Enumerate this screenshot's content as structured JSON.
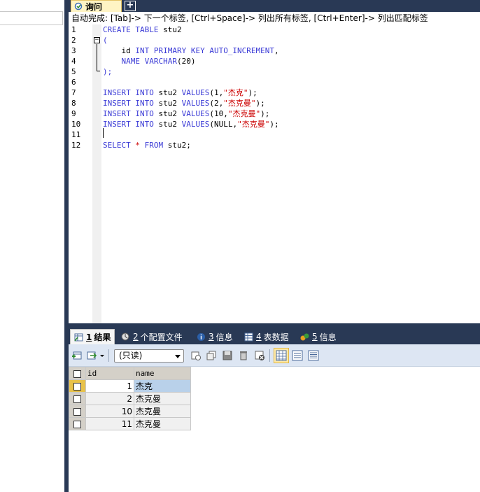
{
  "query_tab": {
    "label": "询问",
    "add_label": "+"
  },
  "hint": "自动完成: [Tab]-> 下一个标签, [Ctrl+Space]-> 列出所有标签, [Ctrl+Enter]-> 列出匹配标签",
  "editor": {
    "line_numbers": [
      "1",
      "2",
      "3",
      "4",
      "5",
      "6",
      "7",
      "8",
      "9",
      "10",
      "11",
      "12"
    ],
    "fold_open": "−",
    "lines": [
      [
        {
          "t": "CREATE TABLE ",
          "c": "kw"
        },
        {
          "t": "stu2",
          "c": ""
        }
      ],
      [
        {
          "t": "(",
          "c": "kw"
        }
      ],
      [
        {
          "t": "    id ",
          "c": ""
        },
        {
          "t": "INT PRIMARY KEY AUTO_INCREMENT",
          "c": "kw"
        },
        {
          "t": ",",
          "c": ""
        }
      ],
      [
        {
          "t": "    NAME VARCHAR",
          "c": "kw"
        },
        {
          "t": "(20)",
          "c": ""
        }
      ],
      [
        {
          "t": ");",
          "c": "kw"
        }
      ],
      [],
      [
        {
          "t": "INSERT INTO ",
          "c": "kw"
        },
        {
          "t": "stu2 ",
          "c": ""
        },
        {
          "t": "VALUES",
          "c": "kw"
        },
        {
          "t": "(1,",
          "c": ""
        },
        {
          "t": "\"杰克\"",
          "c": "str"
        },
        {
          "t": ");",
          "c": ""
        }
      ],
      [
        {
          "t": "INSERT INTO ",
          "c": "kw"
        },
        {
          "t": "stu2 ",
          "c": ""
        },
        {
          "t": "VALUES",
          "c": "kw"
        },
        {
          "t": "(2,",
          "c": ""
        },
        {
          "t": "\"杰克曼\"",
          "c": "str"
        },
        {
          "t": ");",
          "c": ""
        }
      ],
      [
        {
          "t": "INSERT INTO ",
          "c": "kw"
        },
        {
          "t": "stu2 ",
          "c": ""
        },
        {
          "t": "VALUES",
          "c": "kw"
        },
        {
          "t": "(10,",
          "c": ""
        },
        {
          "t": "\"杰克曼\"",
          "c": "str"
        },
        {
          "t": ");",
          "c": ""
        }
      ],
      [
        {
          "t": "INSERT INTO ",
          "c": "kw"
        },
        {
          "t": "stu2 ",
          "c": ""
        },
        {
          "t": "VALUES",
          "c": "kw"
        },
        {
          "t": "(NULL,",
          "c": ""
        },
        {
          "t": "\"杰克曼\"",
          "c": "str"
        },
        {
          "t": ");",
          "c": ""
        }
      ],
      [],
      [
        {
          "t": "SELECT ",
          "c": "kw"
        },
        {
          "t": "* ",
          "c": "str"
        },
        {
          "t": "FROM ",
          "c": "kw"
        },
        {
          "t": "stu2;",
          "c": ""
        }
      ]
    ]
  },
  "result_tabs": [
    {
      "num": "1",
      "label": "结果",
      "icon": "result-grid-icon",
      "active": true
    },
    {
      "num": "2",
      "label": "个配置文件",
      "icon": "profile-icon",
      "active": false
    },
    {
      "num": "3",
      "label": "信息",
      "icon": "info-icon",
      "active": false
    },
    {
      "num": "4",
      "label": "表数据",
      "icon": "table-data-icon",
      "active": false
    },
    {
      "num": "5",
      "label": "信息",
      "icon": "info-history-icon",
      "active": false
    }
  ],
  "toolbar": {
    "readonly_select": "(只读)"
  },
  "grid": {
    "columns": [
      "id",
      "name"
    ],
    "rows": [
      {
        "id": "1",
        "name": "杰克"
      },
      {
        "id": "2",
        "name": "杰克曼"
      },
      {
        "id": "10",
        "name": "杰克曼"
      },
      {
        "id": "11",
        "name": "杰克曼"
      }
    ]
  },
  "colors": {
    "dark_frame": "#293955",
    "keyword": "#3a3ad6",
    "string": "#cc0000",
    "toolbar_bg": "#dde6f3"
  }
}
